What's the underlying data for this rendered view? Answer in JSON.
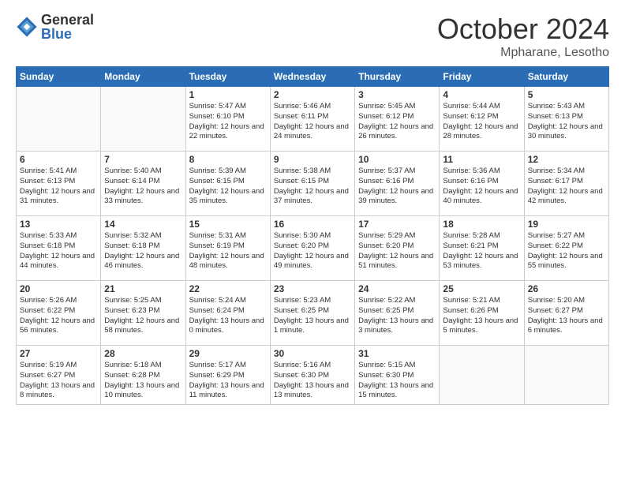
{
  "logo": {
    "general": "General",
    "blue": "Blue"
  },
  "title": {
    "month": "October 2024",
    "location": "Mpharane, Lesotho"
  },
  "weekdays": [
    "Sunday",
    "Monday",
    "Tuesday",
    "Wednesday",
    "Thursday",
    "Friday",
    "Saturday"
  ],
  "weeks": [
    [
      {
        "day": "",
        "info": ""
      },
      {
        "day": "",
        "info": ""
      },
      {
        "day": "1",
        "info": "Sunrise: 5:47 AM\nSunset: 6:10 PM\nDaylight: 12 hours and 22 minutes."
      },
      {
        "day": "2",
        "info": "Sunrise: 5:46 AM\nSunset: 6:11 PM\nDaylight: 12 hours and 24 minutes."
      },
      {
        "day": "3",
        "info": "Sunrise: 5:45 AM\nSunset: 6:12 PM\nDaylight: 12 hours and 26 minutes."
      },
      {
        "day": "4",
        "info": "Sunrise: 5:44 AM\nSunset: 6:12 PM\nDaylight: 12 hours and 28 minutes."
      },
      {
        "day": "5",
        "info": "Sunrise: 5:43 AM\nSunset: 6:13 PM\nDaylight: 12 hours and 30 minutes."
      }
    ],
    [
      {
        "day": "6",
        "info": "Sunrise: 5:41 AM\nSunset: 6:13 PM\nDaylight: 12 hours and 31 minutes."
      },
      {
        "day": "7",
        "info": "Sunrise: 5:40 AM\nSunset: 6:14 PM\nDaylight: 12 hours and 33 minutes."
      },
      {
        "day": "8",
        "info": "Sunrise: 5:39 AM\nSunset: 6:15 PM\nDaylight: 12 hours and 35 minutes."
      },
      {
        "day": "9",
        "info": "Sunrise: 5:38 AM\nSunset: 6:15 PM\nDaylight: 12 hours and 37 minutes."
      },
      {
        "day": "10",
        "info": "Sunrise: 5:37 AM\nSunset: 6:16 PM\nDaylight: 12 hours and 39 minutes."
      },
      {
        "day": "11",
        "info": "Sunrise: 5:36 AM\nSunset: 6:16 PM\nDaylight: 12 hours and 40 minutes."
      },
      {
        "day": "12",
        "info": "Sunrise: 5:34 AM\nSunset: 6:17 PM\nDaylight: 12 hours and 42 minutes."
      }
    ],
    [
      {
        "day": "13",
        "info": "Sunrise: 5:33 AM\nSunset: 6:18 PM\nDaylight: 12 hours and 44 minutes."
      },
      {
        "day": "14",
        "info": "Sunrise: 5:32 AM\nSunset: 6:18 PM\nDaylight: 12 hours and 46 minutes."
      },
      {
        "day": "15",
        "info": "Sunrise: 5:31 AM\nSunset: 6:19 PM\nDaylight: 12 hours and 48 minutes."
      },
      {
        "day": "16",
        "info": "Sunrise: 5:30 AM\nSunset: 6:20 PM\nDaylight: 12 hours and 49 minutes."
      },
      {
        "day": "17",
        "info": "Sunrise: 5:29 AM\nSunset: 6:20 PM\nDaylight: 12 hours and 51 minutes."
      },
      {
        "day": "18",
        "info": "Sunrise: 5:28 AM\nSunset: 6:21 PM\nDaylight: 12 hours and 53 minutes."
      },
      {
        "day": "19",
        "info": "Sunrise: 5:27 AM\nSunset: 6:22 PM\nDaylight: 12 hours and 55 minutes."
      }
    ],
    [
      {
        "day": "20",
        "info": "Sunrise: 5:26 AM\nSunset: 6:22 PM\nDaylight: 12 hours and 56 minutes."
      },
      {
        "day": "21",
        "info": "Sunrise: 5:25 AM\nSunset: 6:23 PM\nDaylight: 12 hours and 58 minutes."
      },
      {
        "day": "22",
        "info": "Sunrise: 5:24 AM\nSunset: 6:24 PM\nDaylight: 13 hours and 0 minutes."
      },
      {
        "day": "23",
        "info": "Sunrise: 5:23 AM\nSunset: 6:25 PM\nDaylight: 13 hours and 1 minute."
      },
      {
        "day": "24",
        "info": "Sunrise: 5:22 AM\nSunset: 6:25 PM\nDaylight: 13 hours and 3 minutes."
      },
      {
        "day": "25",
        "info": "Sunrise: 5:21 AM\nSunset: 6:26 PM\nDaylight: 13 hours and 5 minutes."
      },
      {
        "day": "26",
        "info": "Sunrise: 5:20 AM\nSunset: 6:27 PM\nDaylight: 13 hours and 6 minutes."
      }
    ],
    [
      {
        "day": "27",
        "info": "Sunrise: 5:19 AM\nSunset: 6:27 PM\nDaylight: 13 hours and 8 minutes."
      },
      {
        "day": "28",
        "info": "Sunrise: 5:18 AM\nSunset: 6:28 PM\nDaylight: 13 hours and 10 minutes."
      },
      {
        "day": "29",
        "info": "Sunrise: 5:17 AM\nSunset: 6:29 PM\nDaylight: 13 hours and 11 minutes."
      },
      {
        "day": "30",
        "info": "Sunrise: 5:16 AM\nSunset: 6:30 PM\nDaylight: 13 hours and 13 minutes."
      },
      {
        "day": "31",
        "info": "Sunrise: 5:15 AM\nSunset: 6:30 PM\nDaylight: 13 hours and 15 minutes."
      },
      {
        "day": "",
        "info": ""
      },
      {
        "day": "",
        "info": ""
      }
    ]
  ]
}
